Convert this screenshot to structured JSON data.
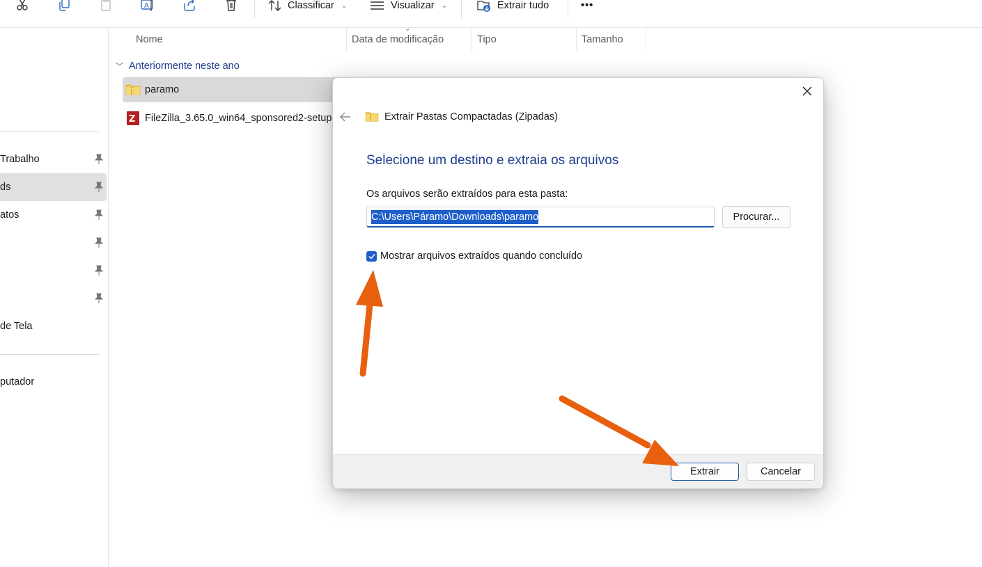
{
  "toolbar": {
    "sort_label": "Classificar",
    "view_label": "Visualizar",
    "extract_all_label": "Extrair tudo",
    "more_label": "•••",
    "icons": [
      "cut-icon",
      "copy-icon",
      "paste-icon",
      "rename-icon",
      "share-icon",
      "delete-icon"
    ]
  },
  "columns": {
    "name": "Nome",
    "modified": "Data de modificação",
    "type": "Tipo",
    "size": "Tamanho"
  },
  "group": {
    "label": "Anteriormente neste ano"
  },
  "files": [
    {
      "name": "paramo",
      "icon": "zip-folder-icon",
      "selected": true
    },
    {
      "name": "FileZilla_3.65.0_win64_sponsored2-setup",
      "icon": "filezilla-icon",
      "selected": false
    }
  ],
  "sidebar": {
    "items": [
      {
        "label": "Trabalho",
        "pinned": true,
        "active": false
      },
      {
        "label": "ds",
        "pinned": true,
        "active": true
      },
      {
        "label": "atos",
        "pinned": true,
        "active": false
      },
      {
        "label": "",
        "pinned": true,
        "active": false
      },
      {
        "label": "",
        "pinned": true,
        "active": false
      },
      {
        "label": "",
        "pinned": true,
        "active": false
      },
      {
        "label": "de Tela",
        "pinned": false,
        "active": false
      },
      {
        "label": "putador",
        "pinned": false,
        "active": false
      }
    ]
  },
  "dialog": {
    "title": "Extrair Pastas Compactadas (Zipadas)",
    "heading": "Selecione um destino e extraia os arquivos",
    "path_label": "Os arquivos serão extraídos para esta pasta:",
    "path_value": "C:\\Users\\Páramo\\Downloads\\paramo",
    "browse_label": "Procurar...",
    "checkbox_label": "Mostrar arquivos extraídos quando concluído",
    "checkbox_checked": true,
    "extract_label": "Extrair",
    "cancel_label": "Cancelar"
  },
  "colors": {
    "accent": "#1d5ec9",
    "heading": "#1e3f8f",
    "annotation_arrow": "#e8600e"
  }
}
